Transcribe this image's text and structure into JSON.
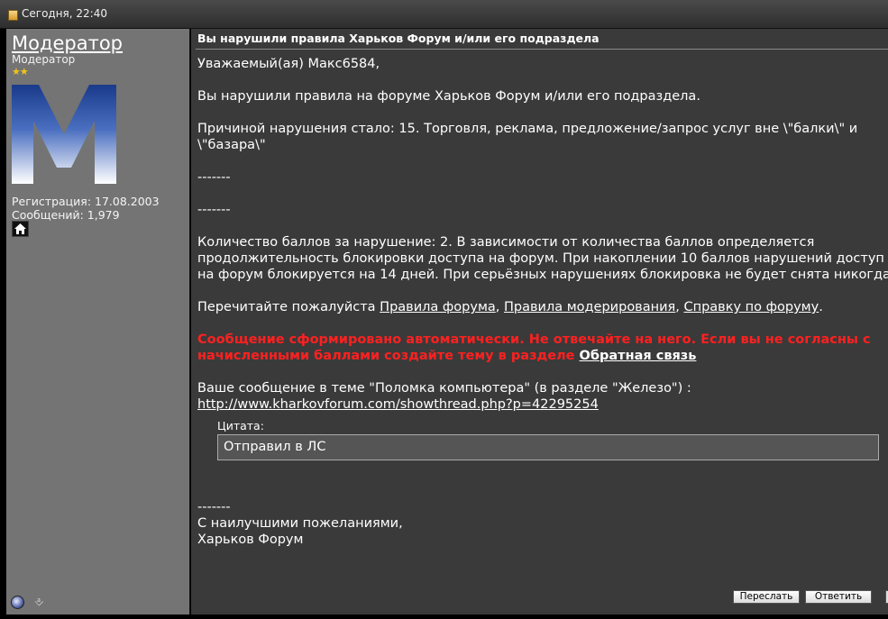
{
  "header": {
    "date": "Сегодня, 22:40"
  },
  "user": {
    "name": "Модератор",
    "title": "Модератор",
    "stars": "★★",
    "avatar_letter": "M",
    "registration": "Регистрация: 17.08.2003",
    "posts": "Сообщений: 1,979"
  },
  "message": {
    "title": "Вы нарушили правила Харьков Форум и/или его подраздела",
    "greeting": "Уважаемый(ая) Макс6584,",
    "line1": "Вы нарушили правила на форуме Харьков Форум и/или его подраздела.",
    "reason_1": "Причиной нарушения стало: 15. Торговля, реклама, предложение/запрос услуг вне \\\"балки\\\" и",
    "reason_2": "\\\"базара\\\"",
    "sep1": "-------",
    "sep2": "-------",
    "points_1": "Количество баллов за нарушение: 2. В зависимости от количества баллов определяется",
    "points_2": "продолжительность блокировки доступа на форум. При накоплении 10 баллов нарушений доступ",
    "points_3": "на форум блокируется на 14 дней. При серьёзных нарушениях блокировка не будет снята никогда",
    "reread_prefix": "Перечитайте пожалуйста ",
    "link_rules": "Правила форума",
    "comma1": ", ",
    "link_moderation": "Правила модерирования",
    "comma2": ", ",
    "link_help": "Справку по форуму",
    "reread_suffix": ".",
    "warning_1": "Сообщение сформировано автоматически. Не отвечайте на него. Если вы не согласны с",
    "warning_2": "начисленными баллами создайте тему в разделе ",
    "warning_link": "Обратная связь",
    "your_post": "Ваше сообщение в теме \"Поломка компьютера\" (в разделе \"Железо\") :",
    "post_url": "http://www.kharkovforum.com/showthread.php?p=42295254",
    "quote_label": "Цитата:",
    "quote_text": "Отправил в ЛС",
    "sep3": "-------",
    "regards": "С наилучшими пожеланиями,",
    "signature": "Харьков Форум"
  },
  "buttons": {
    "forward": "Переслать",
    "reply": "Ответить"
  }
}
